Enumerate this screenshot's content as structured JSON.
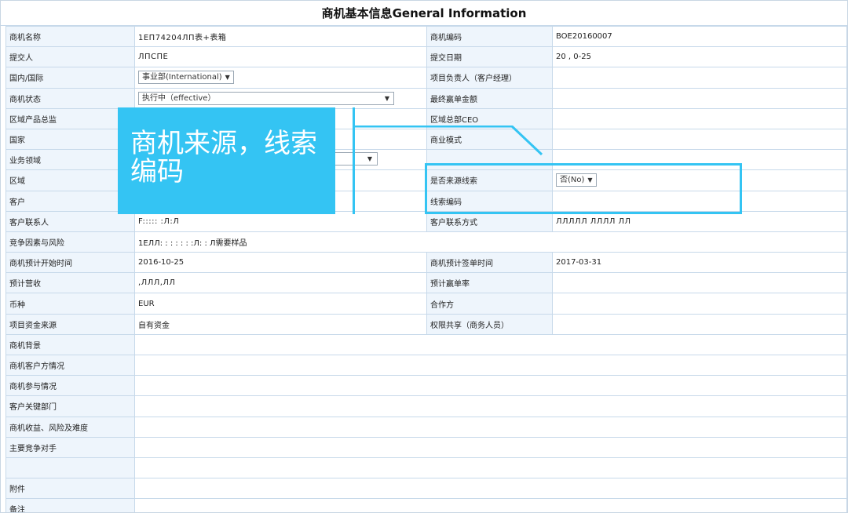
{
  "page": {
    "title": "商机基本信息General Information"
  },
  "rows": [
    {
      "l1": "商机名称",
      "v1": "1ЕΠ74204ЛΠ表+表箱",
      "l2": "商机编码",
      "v2": "BOE20160007"
    },
    {
      "l1": "提交人",
      "v1": "ЛПСПЕ",
      "l2": "提交日期",
      "v2": "20 , 0-25"
    },
    {
      "l1": "国内/国际",
      "v1": "事业部(International)",
      "l2": "项目负责人（客户经理）",
      "v2": ""
    },
    {
      "l1": "商机状态",
      "v1": "执行中（effective）",
      "l2": "最终赢单金额",
      "v2": ""
    },
    {
      "l1": "区域产品总监",
      "v1": "",
      "l2": "区域总部CEO",
      "v2": ""
    },
    {
      "l1": "国家",
      "v1": "",
      "l2": "商业模式",
      "v2": ""
    },
    {
      "l1": "业务领域",
      "v1": "",
      "l2": "",
      "v2": ""
    },
    {
      "l1": "区域",
      "v1": "",
      "l2": "是否来源线索",
      "v2": "否(No)"
    },
    {
      "l1": "客户",
      "v1": "",
      "l2": "线索编码",
      "v2": ""
    },
    {
      "l1": "客户联系人",
      "v1": "F::::: :Л:Л",
      "l2": "客户联系方式",
      "v2": "ЛЛЛЛЛ ЛЛЛЛ ЛЛ"
    },
    {
      "l1": "竞争因素与风险",
      "v1": "1ЕЛЛ: : : : : : :Л: : Л需要样品",
      "l2": "",
      "v2": ""
    },
    {
      "l1": "商机预计开始时间",
      "v1": "2016-10-25",
      "l2": "商机预计签单时间",
      "v2": "2017-03-31"
    },
    {
      "l1": "预计营收",
      "v1": ",ЛЛЛ,ЛЛ",
      "l2": "预计赢单率",
      "v2": ""
    },
    {
      "l1": "币种",
      "v1": "EUR",
      "l2": "合作方",
      "v2": ""
    },
    {
      "l1": "项目资金来源",
      "v1": "自有资金",
      "l2": "权限共享（商务人员）",
      "v2": ""
    }
  ],
  "full_rows": [
    "商机背景",
    "商机客户方情况",
    "商机参与情况",
    "客户关键部门",
    "商机收益、风险及难度",
    "主要竞争对手",
    "",
    "附件",
    "备注"
  ],
  "overlay": {
    "text": "商机来源，线索编码"
  },
  "colors": {
    "accent": "#34c4f3",
    "label_bg": "#eef5fc",
    "border": "#c7d9ea"
  }
}
